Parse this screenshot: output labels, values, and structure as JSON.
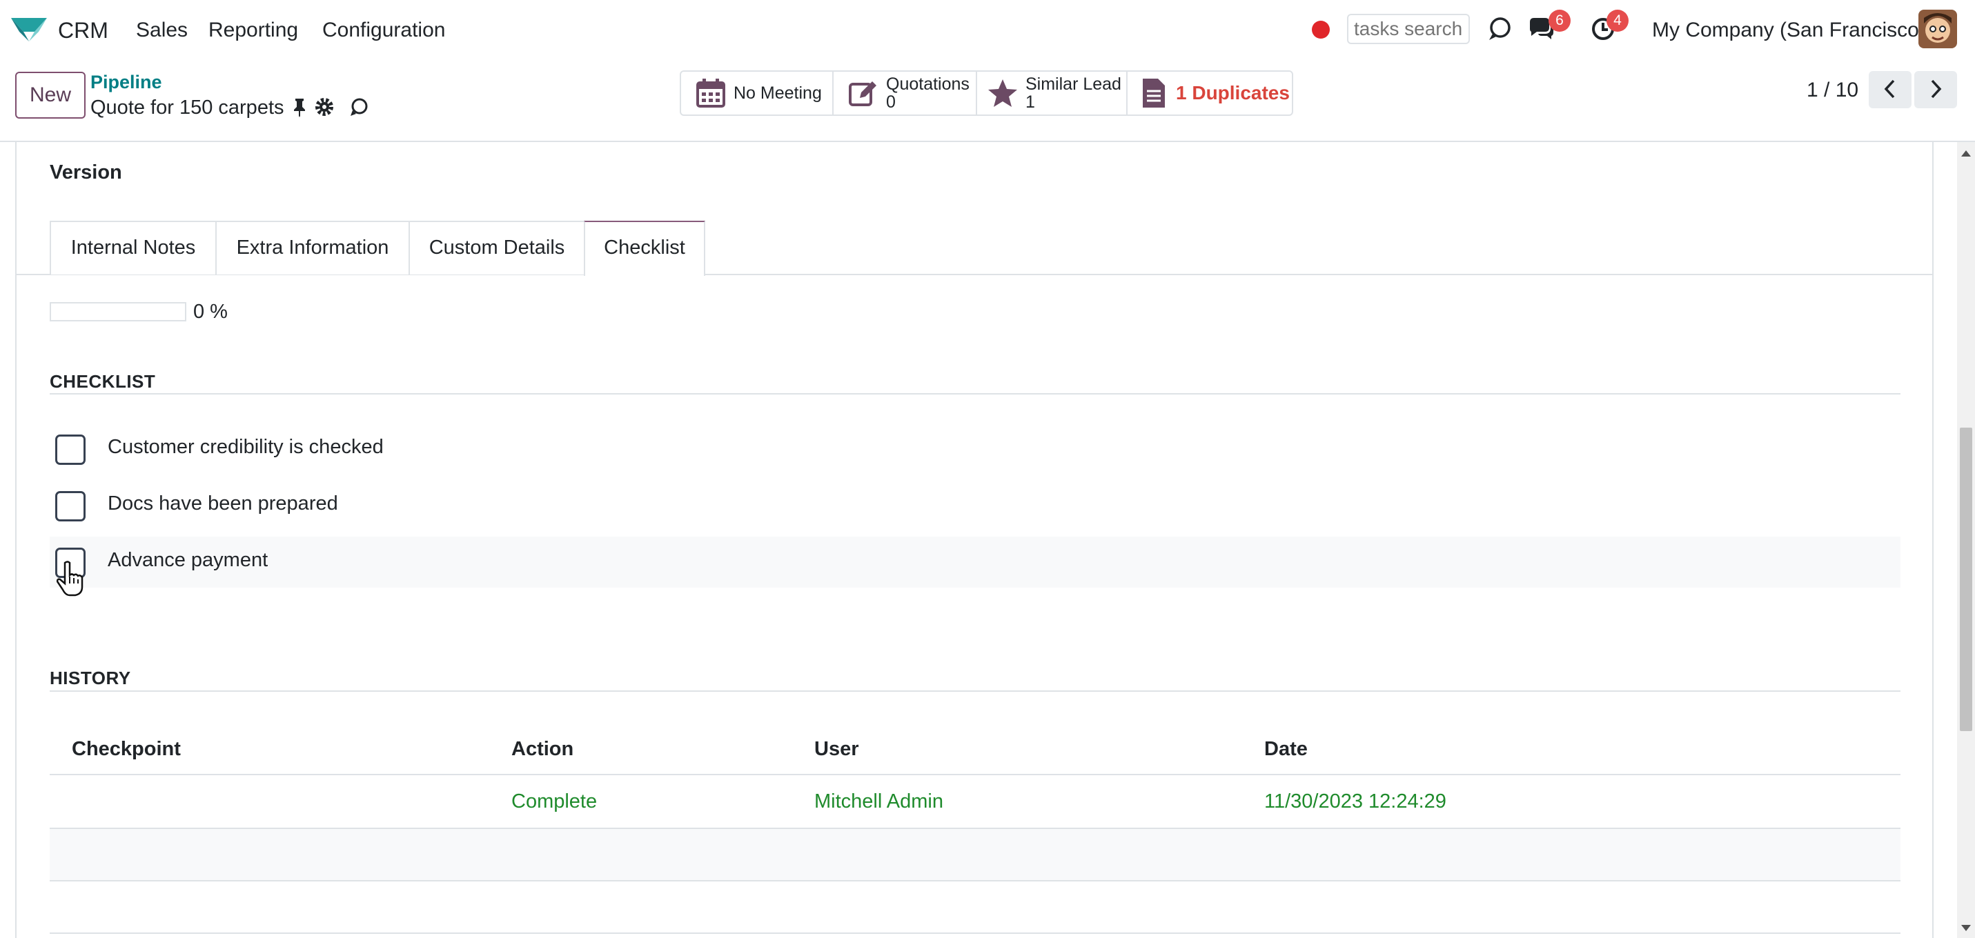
{
  "navbar": {
    "app_name": "CRM",
    "menu": [
      "Sales",
      "Reporting",
      "Configuration"
    ],
    "search_placeholder": "tasks search",
    "messages_badge": "6",
    "activities_badge": "4",
    "company": "My Company (San Francisco)",
    "icons": [
      "crm-logo-icon",
      "record-dot-icon",
      "odoobot-chat-icon",
      "messages-icon",
      "activities-clock-icon",
      "user-avatar"
    ]
  },
  "control": {
    "new_label": "New",
    "breadcrumb_parent": "Pipeline",
    "record_title": "Quote for 150 carpets",
    "smart_buttons": [
      {
        "icon": "calendar-icon",
        "line1": "No Meeting",
        "line2": ""
      },
      {
        "icon": "pencil-square-icon",
        "line1": "Quotations",
        "line2": "0"
      },
      {
        "icon": "star-icon",
        "line1": "Similar Lead",
        "line2": "1"
      },
      {
        "icon": "document-icon",
        "line1": "1 Duplicates",
        "line2": ""
      }
    ],
    "pager": "1 / 10"
  },
  "form": {
    "version_label": "Version",
    "tabs": [
      "Internal Notes",
      "Extra Information",
      "Custom Details",
      "Checklist"
    ],
    "active_tab": "Checklist",
    "progress_value": 0,
    "progress_text": "0 %",
    "checklist_title": "CHECKLIST",
    "checklist_items": [
      {
        "label": "Customer credibility is checked",
        "checked": false
      },
      {
        "label": "Docs have been prepared",
        "checked": false
      },
      {
        "label": "Advance payment",
        "checked": false
      }
    ],
    "history_title": "HISTORY",
    "history_columns": [
      "Checkpoint",
      "Action",
      "User",
      "Date"
    ],
    "history_rows": [
      {
        "checkpoint": "",
        "action": "Complete",
        "user": "Mitchell Admin",
        "date": "11/30/2023 12:24:29"
      }
    ]
  },
  "colors": {
    "accent": "#875a7b",
    "link": "#017e84",
    "duplicates_red": "#d9443b",
    "history_green": "#1f8b2c",
    "badge_red": "#e64d4d"
  }
}
